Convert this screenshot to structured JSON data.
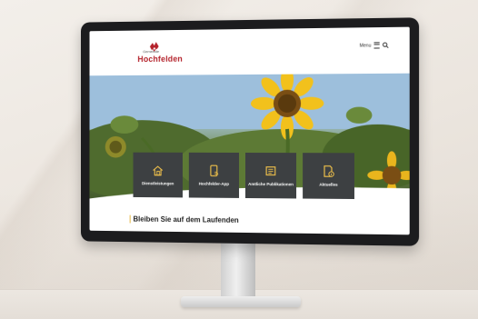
{
  "header": {
    "logo_small": "Gemeinde",
    "logo_name": "Hochfelden",
    "menu_label": "Menu"
  },
  "tiles": [
    {
      "label": "Dienstleistungen",
      "icon": "house-icon"
    },
    {
      "label": "Hochfelder-App",
      "icon": "phone-app-icon"
    },
    {
      "label": "Amtliche Publikationen",
      "icon": "newspaper-icon"
    },
    {
      "label": "Aktuelles",
      "icon": "document-info-icon"
    }
  ],
  "main": {
    "headline": "Bleiben Sie auf dem Laufenden"
  },
  "colors": {
    "brand_red": "#b4222b",
    "tile_bg": "#3d4042",
    "accent_yellow": "#e2b43d"
  }
}
